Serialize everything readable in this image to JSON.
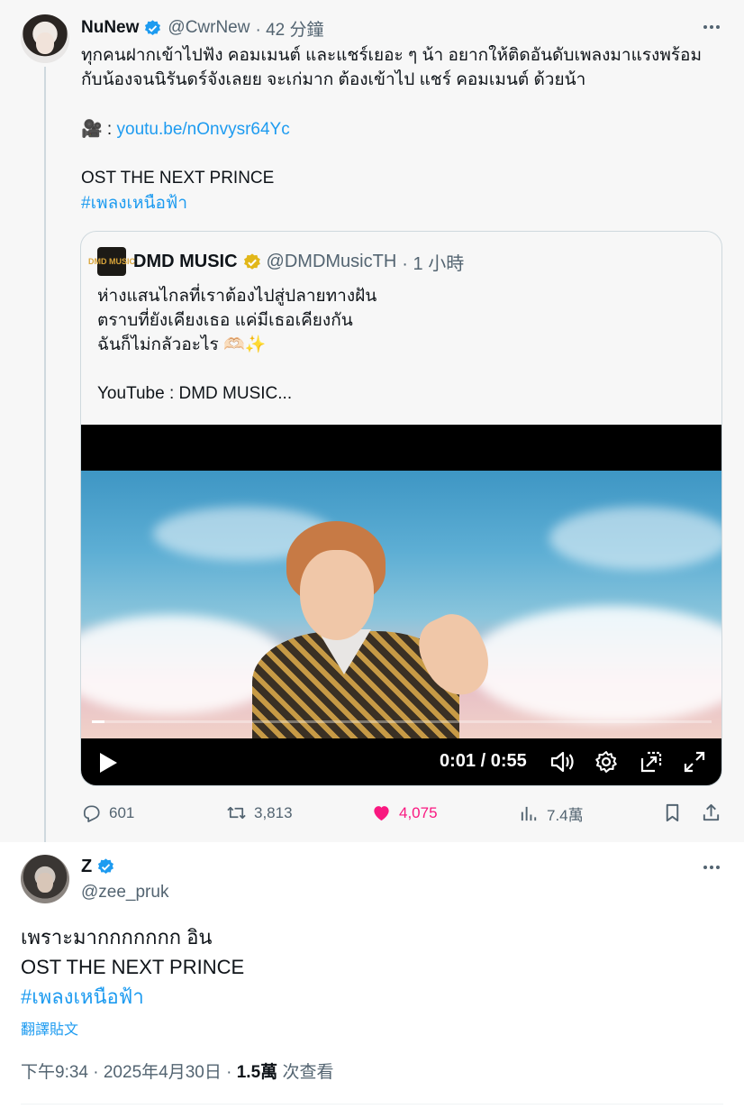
{
  "colors": {
    "accent": "#1d9bf0",
    "like": "#f91880",
    "muted": "#536471",
    "text": "#0f1419",
    "gold": "#e2b719"
  },
  "parent": {
    "name": "NuNew",
    "handle": "@CwrNew",
    "time": "· 42 分鐘",
    "body_line1": "ทุกคนฝากเข้าไปฟัง คอมเมนต์ และแชร์เยอะ ๆ น้า อยากให้ติดอันดับเพลงมาแรงพร้อม",
    "body_line2": "กับน้องจนนิรันดร์จังเลยย จะเก่มาก ต้องเข้าไป แชร์ คอมเมนต์ ด้วยน้า",
    "camera_emoji": "🎥 :",
    "link": "youtu.be/nOnvysr64Yc",
    "ost": "OST THE NEXT PRINCE",
    "hashtag": "#เพลงเหนือฟ้า"
  },
  "quote": {
    "logo_text": "DMD MUSIC",
    "name": "DMD MUSIC",
    "handle": "@DMDMusicTH",
    "time": "· 1 小時",
    "line1": "ห่างแสนไกลที่เราต้องไปสู่ปลายทางฝัน",
    "line2": "ตราบที่ยังเคียงเธอ แค่มีเธอเคียงกัน",
    "line3": "ฉันก็ไม่กลัวอะไร 🫶🏻✨",
    "line4": "YouTube : DMD MUSIC...",
    "video": {
      "time": "0:01 / 0:55",
      "progress": 0.02
    }
  },
  "actions": {
    "replies": "601",
    "retweets": "3,813",
    "likes": "4,075",
    "views": "7.4萬"
  },
  "main": {
    "name": "Z",
    "handle": "@zee_pruk",
    "line1": "เพราะมากกกกกกก อิน",
    "line2": "OST THE NEXT PRINCE",
    "hashtag": "#เพลงเหนือฟ้า",
    "translate": "翻譯貼文",
    "timestamp": "下午9:34 · 2025年4月30日 ·",
    "views_count": "1.5萬",
    "views_label": "次查看"
  }
}
